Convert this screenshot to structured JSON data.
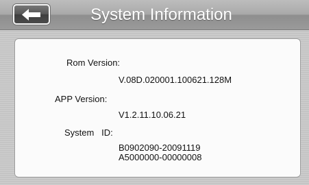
{
  "header": {
    "title": "System Information",
    "back_icon": "back-arrow-icon"
  },
  "info": {
    "rom_label": "Rom Version:",
    "rom_value": "V.08D.020001.100621.128M",
    "app_label": "APP Version:",
    "app_value": "V1.2.11.10.06.21",
    "system_id_label": "System   ID:",
    "system_id_line1": "B0902090-20091119",
    "system_id_line2": "A5000000-00000008"
  },
  "colors": {
    "header_bg": "#a6a6a6",
    "panel_bg": "#fbfbfb",
    "page_bg": "#c9c9c9"
  }
}
